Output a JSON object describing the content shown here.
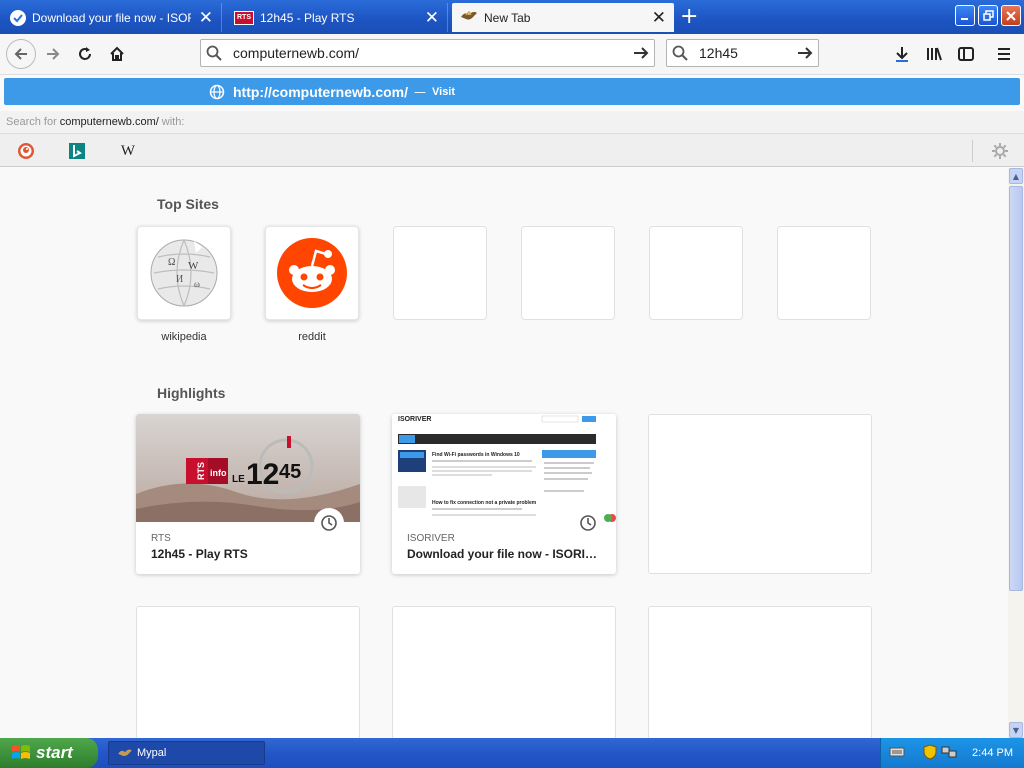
{
  "browser": {
    "tabs": [
      {
        "label": "Download your file now - ISORIVER",
        "icon": "check-circle-icon",
        "active": false
      },
      {
        "label": "12h45 - Play RTS",
        "icon": "rts-icon",
        "active": false
      },
      {
        "label": "New Tab",
        "icon": "mypal-icon",
        "active": true
      }
    ]
  },
  "toolbar": {
    "url": "computernewb.com/",
    "search_value": "12h45"
  },
  "autocomplete": {
    "url": "http://computernewb.com/",
    "separator": "—",
    "action": "Visit",
    "search_for_prefix": "Search for",
    "search_for_query": "computernewb.com/",
    "search_for_suffix": "with:",
    "engines": [
      "duckduckgo-icon",
      "bing-icon",
      "wikipedia-icon"
    ]
  },
  "newtab": {
    "top_sites_title": "Top Sites",
    "top_sites": [
      {
        "label": "wikipedia",
        "icon": "wikipedia-globe-icon"
      },
      {
        "label": "reddit",
        "icon": "reddit-icon"
      },
      {
        "label": "",
        "icon": ""
      },
      {
        "label": "",
        "icon": ""
      },
      {
        "label": "",
        "icon": ""
      },
      {
        "label": "",
        "icon": ""
      }
    ],
    "highlights_title": "Highlights",
    "highlights": [
      {
        "source": "RTS",
        "title": "12h45 - Play RTS",
        "thumb_text": "RTS Info LE 12 45"
      },
      {
        "source": "ISORIVER",
        "title": "Download your file now - ISORI…",
        "thumb_heading": "ISORIVER",
        "thumb_post_1": "Find Wi-Fi passwords in Windows 10",
        "thumb_post_2": "How to fix connection not a private problem"
      }
    ]
  },
  "taskbar": {
    "start_label": "start",
    "task_label": "Mypal",
    "clock": "2:44 PM"
  },
  "colors": {
    "titlebar": "#1d54c2",
    "autocomplete_highlight": "#3d9ae8",
    "reddit": "#ff4500",
    "start_green": "#3a8f38"
  }
}
